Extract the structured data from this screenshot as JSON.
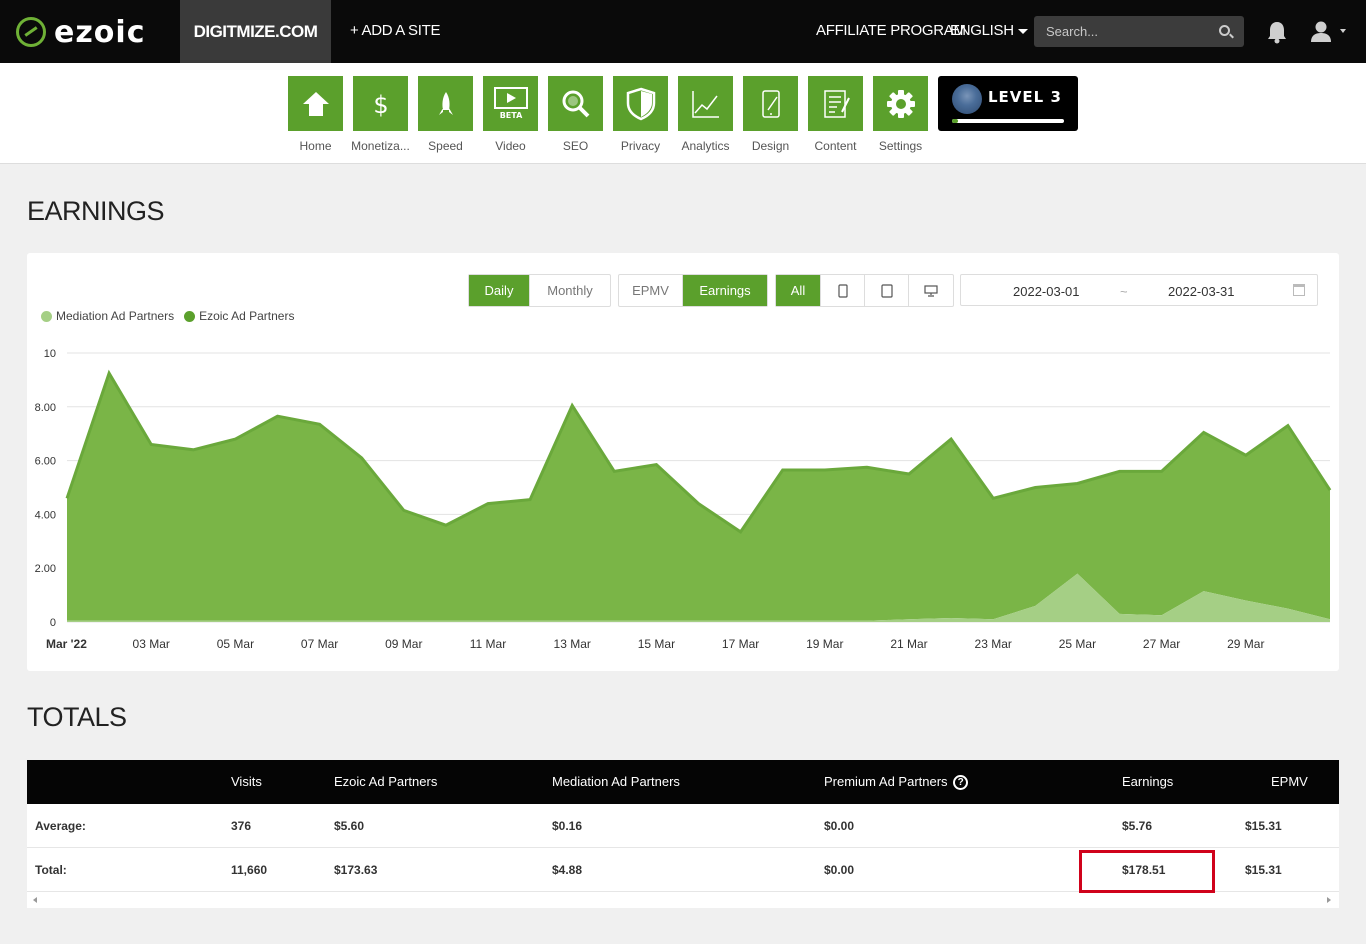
{
  "header": {
    "logo_text": "ezoic",
    "site_name": "DIGITMIZE.COM",
    "add_site": "+ ADD A SITE",
    "affiliate": "AFFILIATE PROGRAM",
    "language": "ENGLISH",
    "search_placeholder": "Search..."
  },
  "toolbar": {
    "items": [
      {
        "label": "Home",
        "icon": "home-icon"
      },
      {
        "label": "Monetiza...",
        "icon": "dollar-icon"
      },
      {
        "label": "Speed",
        "icon": "rocket-icon"
      },
      {
        "label": "Video",
        "icon": "video-icon",
        "badge": "BETA"
      },
      {
        "label": "SEO",
        "icon": "magnifier-icon"
      },
      {
        "label": "Privacy",
        "icon": "shield-icon"
      },
      {
        "label": "Analytics",
        "icon": "line-chart-icon"
      },
      {
        "label": "Design",
        "icon": "design-icon"
      },
      {
        "label": "Content",
        "icon": "document-icon"
      },
      {
        "label": "Settings",
        "icon": "gear-icon"
      }
    ],
    "level": {
      "text": "LEVEL 3",
      "progress_fraction": 0.05
    }
  },
  "earnings": {
    "title": "EARNINGS",
    "period_buttons": [
      {
        "label": "Daily",
        "active": true
      },
      {
        "label": "Monthly",
        "active": false
      }
    ],
    "metric_buttons": [
      {
        "label": "EPMV",
        "active": false
      },
      {
        "label": "Earnings",
        "active": true
      }
    ],
    "device_buttons": [
      {
        "label": "All",
        "active": true
      },
      {
        "icon": "phone-icon"
      },
      {
        "icon": "tablet-icon"
      },
      {
        "icon": "desktop-icon"
      }
    ],
    "date_from": "2022-03-01",
    "date_sep": "~",
    "date_to": "2022-03-31"
  },
  "chart_data": {
    "type": "area",
    "x": [
      "Mar '22",
      "02 Mar",
      "03 Mar",
      "04 Mar",
      "05 Mar",
      "06 Mar",
      "07 Mar",
      "08 Mar",
      "09 Mar",
      "10 Mar",
      "11 Mar",
      "12 Mar",
      "13 Mar",
      "14 Mar",
      "15 Mar",
      "16 Mar",
      "17 Mar",
      "18 Mar",
      "19 Mar",
      "20 Mar",
      "21 Mar",
      "22 Mar",
      "23 Mar",
      "24 Mar",
      "25 Mar",
      "26 Mar",
      "27 Mar",
      "28 Mar",
      "29 Mar",
      "30 Mar",
      "31 Mar"
    ],
    "tick_labels": [
      "Mar '22",
      "03 Mar",
      "05 Mar",
      "07 Mar",
      "09 Mar",
      "11 Mar",
      "13 Mar",
      "15 Mar",
      "17 Mar",
      "19 Mar",
      "21 Mar",
      "23 Mar",
      "25 Mar",
      "27 Mar",
      "29 Mar"
    ],
    "y_ticks": [
      "0",
      "2.00",
      "4.00",
      "6.00",
      "8.00",
      "10"
    ],
    "ylim": [
      0,
      10
    ],
    "stacked": true,
    "grid": true,
    "legend_placement": "top-left",
    "series": [
      {
        "name": "Mediation Ad Partners",
        "color": "#a5cf85",
        "values": [
          0.05,
          0.05,
          0.05,
          0.05,
          0.05,
          0.05,
          0.05,
          0.05,
          0.05,
          0.05,
          0.05,
          0.05,
          0.05,
          0.05,
          0.05,
          0.05,
          0.05,
          0.05,
          0.05,
          0.05,
          0.1,
          0.15,
          0.1,
          0.6,
          1.8,
          0.3,
          0.25,
          1.15,
          0.8,
          0.5,
          0.1
        ]
      },
      {
        "name": "Ezoic Ad Partners",
        "color": "#6aa83b",
        "values": [
          4.55,
          9.2,
          6.55,
          6.35,
          6.75,
          7.6,
          7.3,
          6.05,
          4.1,
          3.55,
          4.35,
          4.5,
          8.0,
          5.55,
          5.8,
          4.35,
          3.3,
          5.6,
          5.6,
          5.7,
          5.4,
          6.65,
          4.5,
          4.4,
          3.35,
          5.3,
          5.35,
          5.9,
          5.4,
          6.8,
          4.8
        ]
      }
    ]
  },
  "totals": {
    "title": "TOTALS",
    "columns": [
      "Visits",
      "Ezoic Ad Partners",
      "Mediation Ad Partners",
      "Premium Ad Partners",
      "Earnings",
      "EPMV"
    ],
    "rows": [
      {
        "label": "Average:",
        "values": [
          "376",
          "$5.60",
          "$0.16",
          "$0.00",
          "$5.76",
          "$15.31"
        ]
      },
      {
        "label": "Total:",
        "values": [
          "11,660",
          "$173.63",
          "$4.88",
          "$0.00",
          "$178.51",
          "$15.31"
        ]
      }
    ]
  }
}
